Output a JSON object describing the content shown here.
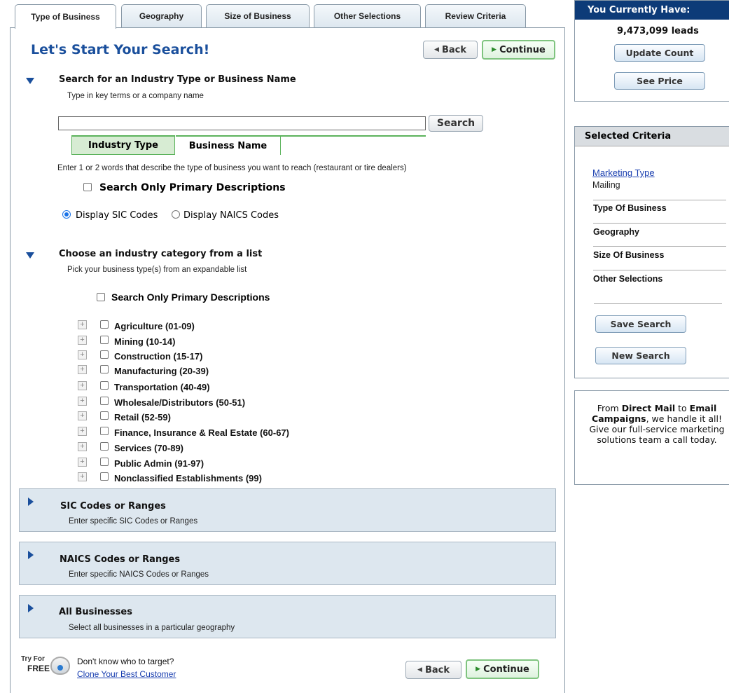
{
  "tabs": [
    {
      "label": "Type of Business"
    },
    {
      "label": "Geography"
    },
    {
      "label": "Size of Business"
    },
    {
      "label": "Other Selections"
    },
    {
      "label": "Review Criteria"
    }
  ],
  "main": {
    "title": "Let's Start Your Search!",
    "back_label": "Back",
    "continue_label": "Continue",
    "section1": {
      "title": "Search for an Industry Type or Business Name",
      "subtitle": "Type in key terms or a company name",
      "search_value": "",
      "search_button": "Search",
      "subtab_industry": "Industry Type",
      "subtab_business": "Business Name",
      "hint": "Enter 1 or 2 words that describe the type of business you want to reach (restaurant or tire dealers)",
      "primary_only_label": "Search Only Primary Descriptions",
      "radio_sic": "Display SIC Codes",
      "radio_naics": "Display NAICS Codes"
    },
    "section2": {
      "title": "Choose an industry category from a list",
      "subtitle": "Pick your business type(s) from an expandable list",
      "primary_only_label": "Search Only Primary Descriptions",
      "industries": [
        "Agriculture (01-09)",
        "Mining (10-14)",
        "Construction (15-17)",
        "Manufacturing (20-39)",
        "Transportation (40-49)",
        "Wholesale/Distributors (50-51)",
        "Retail (52-59)",
        "Finance, Insurance & Real Estate (60-67)",
        "Services (70-89)",
        "Public Admin (91-97)",
        "Nonclassified Establishments (99)"
      ]
    },
    "collapsed": [
      {
        "title": "SIC Codes or Ranges",
        "subtitle": "Enter specific SIC Codes or Ranges"
      },
      {
        "title": "NAICS Codes or Ranges",
        "subtitle": "Enter specific NAICS Codes or Ranges"
      },
      {
        "title": "All Businesses",
        "subtitle": "Select all businesses in a particular geography"
      }
    ],
    "footer": {
      "try_label_1": "Try For",
      "try_label_2": "FREE",
      "question": "Don't know who to target?",
      "clone_link": "Clone Your Best Customer",
      "back_label": "Back",
      "continue_label": "Continue"
    }
  },
  "sidebar": {
    "count_header": "You Currently Have:",
    "count_value": "9,473,099 leads",
    "update_button": "Update Count",
    "price_button": "See Price",
    "criteria_header": "Selected Criteria",
    "marketing_type_link": "Marketing Type",
    "marketing_type_value": "Mailing",
    "criteria_items": [
      "Type Of Business",
      "Geography",
      "Size Of Business",
      "Other Selections"
    ],
    "save_button": "Save Search",
    "new_button": "New Search",
    "promo": {
      "t1": "From ",
      "b1": "Direct Mail",
      "t2": " to ",
      "b2": "Email Campaigns",
      "t3": ", we handle it all! Give our full-service marketing solutions team a call today."
    }
  },
  "colors": {
    "title_blue": "#1a4f9c",
    "panel_blue": "#dde7ef",
    "header_navy": "#0d3b78",
    "green_border": "#7fc47f",
    "link_blue": "#1a3fb0"
  }
}
